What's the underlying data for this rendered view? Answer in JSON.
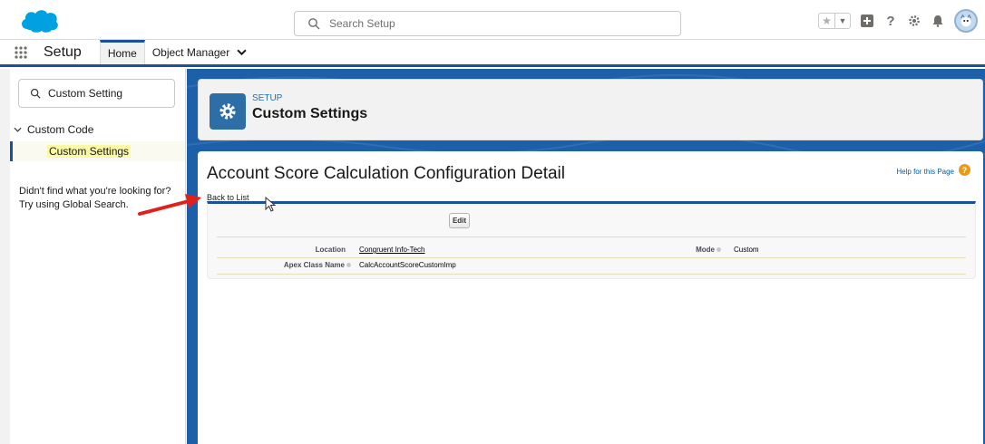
{
  "header": {
    "search_placeholder": "Search Setup"
  },
  "nav": {
    "app_name": "Setup",
    "tabs": [
      {
        "label": "Home"
      },
      {
        "label": "Object Manager"
      }
    ]
  },
  "sidebar": {
    "quick_find_value": "Custom Setting",
    "tree": {
      "node_label": "Custom Code",
      "leaf_label": "Custom Settings"
    },
    "help_line1": "Didn't find what you're looking for?",
    "help_line2": "Try using Global Search."
  },
  "setup_header": {
    "eyebrow": "SETUP",
    "title": "Custom Settings"
  },
  "detail": {
    "title": "Account Score Calculation Configuration Detail",
    "help_link": "Help for this Page",
    "help_badge": "?",
    "back_link": "Back to List",
    "edit_label": "Edit",
    "fields": {
      "location_label": "Location",
      "location_value": "Congruent Info-Tech",
      "mode_label": "Mode",
      "mode_value": "Custom",
      "apex_label": "Apex Class Name",
      "apex_value": "CalcAccountScoreCustomImp"
    }
  },
  "colors": {
    "brand_blue": "#1b5297",
    "content_blue": "#1d5fa8",
    "setup_icon_blue": "#2e6ea7",
    "highlight_yellow": "#fbf9a5",
    "annotation_red": "#e0201c",
    "help_orange": "#e89b1b"
  }
}
